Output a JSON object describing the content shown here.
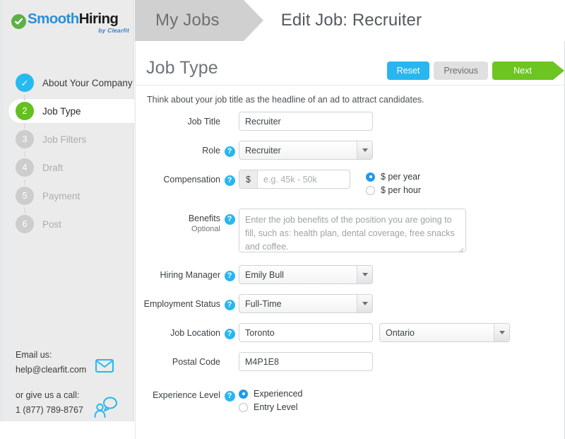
{
  "brand": {
    "name_part1": "Smooth",
    "name_part2": "Hiring",
    "tagline": "by Clearfit",
    "check_color": "#5eb045",
    "blue": "#2b8fd6"
  },
  "header": {
    "breadcrumb_root": "My Jobs",
    "breadcrumb_current": "Edit Job: Recruiter"
  },
  "sidebar": {
    "steps": [
      {
        "badge": "✓",
        "label": "About Your Company",
        "state": "done"
      },
      {
        "badge": "2",
        "label": "Job Type",
        "state": "active"
      },
      {
        "badge": "3",
        "label": "Job Filters",
        "state": "todo"
      },
      {
        "badge": "4",
        "label": "Draft",
        "state": "todo"
      },
      {
        "badge": "5",
        "label": "Payment",
        "state": "todo"
      },
      {
        "badge": "6",
        "label": "Post",
        "state": "todo"
      }
    ],
    "contact": {
      "email_heading": "Email us:",
      "email_address": "help@clearfit.com",
      "call_heading": "or give us a call:",
      "phone": "1 (877) 789-8767"
    }
  },
  "page": {
    "title": "Job Type",
    "subtitle": "Think about your job title as the headline of an ad to attract candidates."
  },
  "actions": {
    "reset": "Reset",
    "previous": "Previous",
    "next": "Next",
    "reset_color": "#29b6f0",
    "next_color": "#6cc521"
  },
  "form": {
    "help_glyph": "?",
    "job_title": {
      "label": "Job Title",
      "value": "Recruiter",
      "placeholder": ""
    },
    "role": {
      "label": "Role",
      "value": "Recruiter"
    },
    "compensation": {
      "label": "Compensation",
      "currency_symbol": "$",
      "value": "",
      "placeholder": "e.g. 45k - 50k",
      "options": [
        {
          "label": "$ per year",
          "selected": true
        },
        {
          "label": "$ per hour",
          "selected": false
        }
      ]
    },
    "benefits": {
      "label": "Benefits",
      "sublabel": "Optional",
      "value": "",
      "placeholder": "Enter the job benefits of the position you are going to fill, such as: health plan, dental coverage, free snacks and coffee."
    },
    "hiring_manager": {
      "label": "Hiring Manager",
      "value": "Emily Bull"
    },
    "employment_status": {
      "label": "Employment Status",
      "value": "Full-Time"
    },
    "job_location": {
      "label": "Job Location",
      "city_value": "Toronto",
      "city_placeholder": "",
      "province_value": "Ontario"
    },
    "postal_code": {
      "label": "Postal Code",
      "value": "M4P1E8",
      "placeholder": ""
    },
    "experience_level": {
      "label": "Experience Level",
      "options": [
        {
          "label": "Experienced",
          "selected": true
        },
        {
          "label": "Entry Level",
          "selected": false
        }
      ]
    }
  }
}
